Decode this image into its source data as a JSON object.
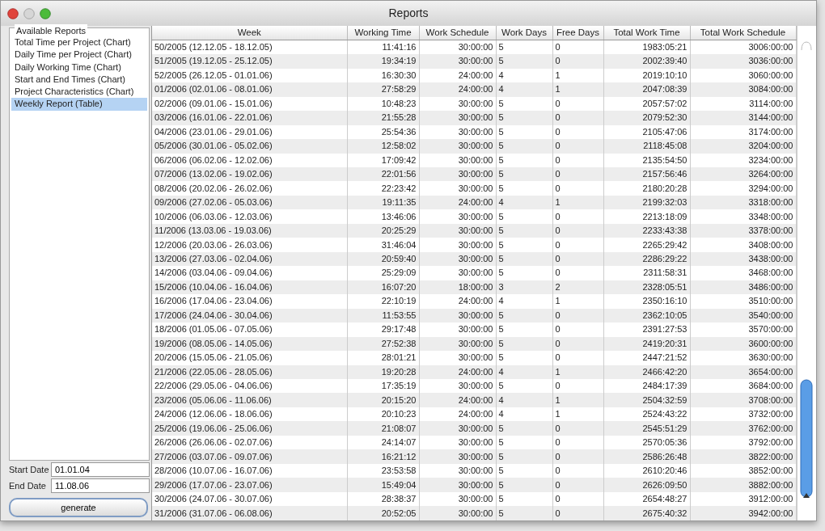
{
  "window": {
    "title": "Reports"
  },
  "reports": {
    "legend": "Available Reports",
    "items": [
      {
        "label": "Total Time per Project (Chart)",
        "selected": false
      },
      {
        "label": "Daily Time per Project (Chart)",
        "selected": false
      },
      {
        "label": "Daily Working Time (Chart)",
        "selected": false
      },
      {
        "label": "Start and End Times (Chart)",
        "selected": false
      },
      {
        "label": "Project Characteristics (Chart)",
        "selected": false
      },
      {
        "label": "Weekly Report (Table)",
        "selected": true
      }
    ]
  },
  "start_date": {
    "label": "Start Date",
    "value": "01.01.04"
  },
  "end_date": {
    "label": "End Date",
    "value": "11.08.06"
  },
  "generate_button": "generate",
  "table": {
    "columns": [
      {
        "label": "Week"
      },
      {
        "label": "Working Time"
      },
      {
        "label": "Work Schedule"
      },
      {
        "label": "Work Days"
      },
      {
        "label": "Free Days"
      },
      {
        "label": "Total Work Time"
      },
      {
        "label": "Total Work Schedule"
      }
    ],
    "rows": [
      [
        "50/2005 (12.12.05 - 18.12.05)",
        "11:41:16",
        "30:00:00",
        "5",
        "0",
        "1983:05:21",
        "3006:00:00"
      ],
      [
        "51/2005 (19.12.05 - 25.12.05)",
        "19:34:19",
        "30:00:00",
        "5",
        "0",
        "2002:39:40",
        "3036:00:00"
      ],
      [
        "52/2005 (26.12.05 - 01.01.06)",
        "16:30:30",
        "24:00:00",
        "4",
        "1",
        "2019:10:10",
        "3060:00:00"
      ],
      [
        "01/2006 (02.01.06 - 08.01.06)",
        "27:58:29",
        "24:00:00",
        "4",
        "1",
        "2047:08:39",
        "3084:00:00"
      ],
      [
        "02/2006 (09.01.06 - 15.01.06)",
        "10:48:23",
        "30:00:00",
        "5",
        "0",
        "2057:57:02",
        "3114:00:00"
      ],
      [
        "03/2006 (16.01.06 - 22.01.06)",
        "21:55:28",
        "30:00:00",
        "5",
        "0",
        "2079:52:30",
        "3144:00:00"
      ],
      [
        "04/2006 (23.01.06 - 29.01.06)",
        "25:54:36",
        "30:00:00",
        "5",
        "0",
        "2105:47:06",
        "3174:00:00"
      ],
      [
        "05/2006 (30.01.06 - 05.02.06)",
        "12:58:02",
        "30:00:00",
        "5",
        "0",
        "2118:45:08",
        "3204:00:00"
      ],
      [
        "06/2006 (06.02.06 - 12.02.06)",
        "17:09:42",
        "30:00:00",
        "5",
        "0",
        "2135:54:50",
        "3234:00:00"
      ],
      [
        "07/2006 (13.02.06 - 19.02.06)",
        "22:01:56",
        "30:00:00",
        "5",
        "0",
        "2157:56:46",
        "3264:00:00"
      ],
      [
        "08/2006 (20.02.06 - 26.02.06)",
        "22:23:42",
        "30:00:00",
        "5",
        "0",
        "2180:20:28",
        "3294:00:00"
      ],
      [
        "09/2006 (27.02.06 - 05.03.06)",
        "19:11:35",
        "24:00:00",
        "4",
        "1",
        "2199:32:03",
        "3318:00:00"
      ],
      [
        "10/2006 (06.03.06 - 12.03.06)",
        "13:46:06",
        "30:00:00",
        "5",
        "0",
        "2213:18:09",
        "3348:00:00"
      ],
      [
        "11/2006 (13.03.06 - 19.03.06)",
        "20:25:29",
        "30:00:00",
        "5",
        "0",
        "2233:43:38",
        "3378:00:00"
      ],
      [
        "12/2006 (20.03.06 - 26.03.06)",
        "31:46:04",
        "30:00:00",
        "5",
        "0",
        "2265:29:42",
        "3408:00:00"
      ],
      [
        "13/2006 (27.03.06 - 02.04.06)",
        "20:59:40",
        "30:00:00",
        "5",
        "0",
        "2286:29:22",
        "3438:00:00"
      ],
      [
        "14/2006 (03.04.06 - 09.04.06)",
        "25:29:09",
        "30:00:00",
        "5",
        "0",
        "2311:58:31",
        "3468:00:00"
      ],
      [
        "15/2006 (10.04.06 - 16.04.06)",
        "16:07:20",
        "18:00:00",
        "3",
        "2",
        "2328:05:51",
        "3486:00:00"
      ],
      [
        "16/2006 (17.04.06 - 23.04.06)",
        "22:10:19",
        "24:00:00",
        "4",
        "1",
        "2350:16:10",
        "3510:00:00"
      ],
      [
        "17/2006 (24.04.06 - 30.04.06)",
        "11:53:55",
        "30:00:00",
        "5",
        "0",
        "2362:10:05",
        "3540:00:00"
      ],
      [
        "18/2006 (01.05.06 - 07.05.06)",
        "29:17:48",
        "30:00:00",
        "5",
        "0",
        "2391:27:53",
        "3570:00:00"
      ],
      [
        "19/2006 (08.05.06 - 14.05.06)",
        "27:52:38",
        "30:00:00",
        "5",
        "0",
        "2419:20:31",
        "3600:00:00"
      ],
      [
        "20/2006 (15.05.06 - 21.05.06)",
        "28:01:21",
        "30:00:00",
        "5",
        "0",
        "2447:21:52",
        "3630:00:00"
      ],
      [
        "21/2006 (22.05.06 - 28.05.06)",
        "19:20:28",
        "24:00:00",
        "4",
        "1",
        "2466:42:20",
        "3654:00:00"
      ],
      [
        "22/2006 (29.05.06 - 04.06.06)",
        "17:35:19",
        "30:00:00",
        "5",
        "0",
        "2484:17:39",
        "3684:00:00"
      ],
      [
        "23/2006 (05.06.06 - 11.06.06)",
        "20:15:20",
        "24:00:00",
        "4",
        "1",
        "2504:32:59",
        "3708:00:00"
      ],
      [
        "24/2006 (12.06.06 - 18.06.06)",
        "20:10:23",
        "24:00:00",
        "4",
        "1",
        "2524:43:22",
        "3732:00:00"
      ],
      [
        "25/2006 (19.06.06 - 25.06.06)",
        "21:08:07",
        "30:00:00",
        "5",
        "0",
        "2545:51:29",
        "3762:00:00"
      ],
      [
        "26/2006 (26.06.06 - 02.07.06)",
        "24:14:07",
        "30:00:00",
        "5",
        "0",
        "2570:05:36",
        "3792:00:00"
      ],
      [
        "27/2006 (03.07.06 - 09.07.06)",
        "16:21:12",
        "30:00:00",
        "5",
        "0",
        "2586:26:48",
        "3822:00:00"
      ],
      [
        "28/2006 (10.07.06 - 16.07.06)",
        "23:53:58",
        "30:00:00",
        "5",
        "0",
        "2610:20:46",
        "3852:00:00"
      ],
      [
        "29/2006 (17.07.06 - 23.07.06)",
        "15:49:04",
        "30:00:00",
        "5",
        "0",
        "2626:09:50",
        "3882:00:00"
      ],
      [
        "30/2006 (24.07.06 - 30.07.06)",
        "28:38:37",
        "30:00:00",
        "5",
        "0",
        "2654:48:27",
        "3912:00:00"
      ],
      [
        "31/2006 (31.07.06 - 06.08.06)",
        "20:52:05",
        "30:00:00",
        "5",
        "0",
        "2675:40:32",
        "3942:00:00"
      ]
    ]
  }
}
